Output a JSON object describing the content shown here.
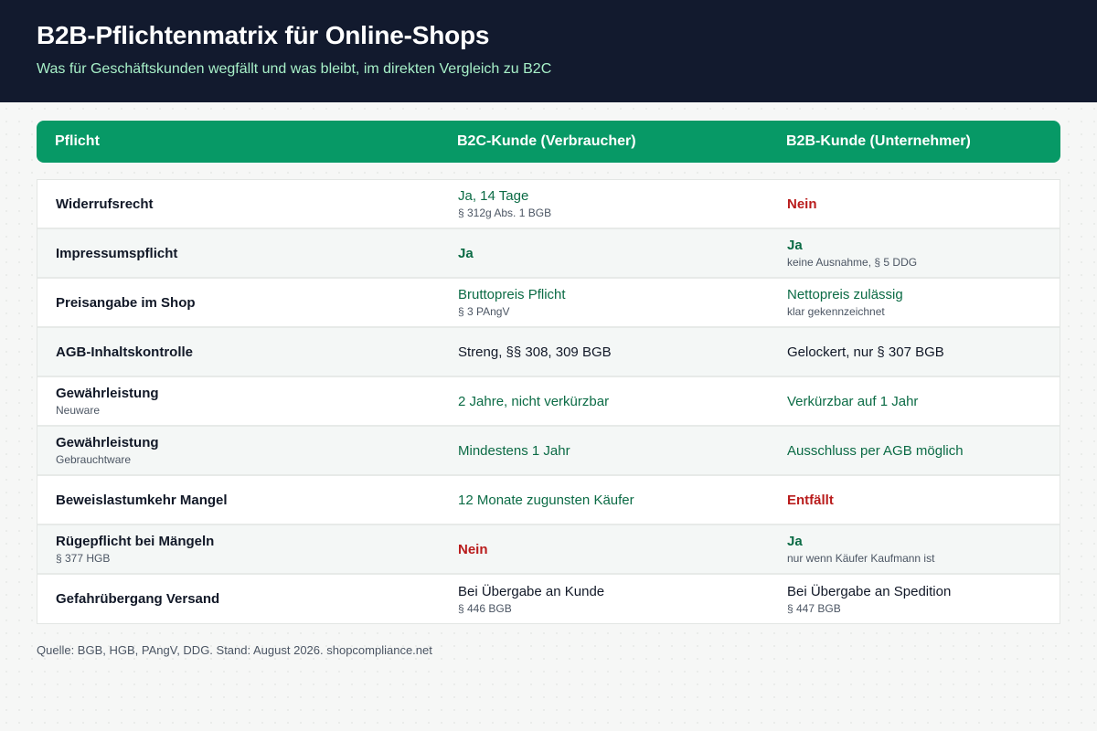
{
  "header": {
    "title": "B2B-Pflichtenmatrix für Online-Shops",
    "subtitle": "Was für Geschäftskunden wegfällt und was bleibt, im direkten Vergleich zu B2C"
  },
  "table": {
    "columns": [
      "Pflicht",
      "B2C-Kunde (Verbraucher)",
      "B2B-Kunde (Unternehmer)"
    ],
    "rows": [
      {
        "pflicht": "Widerrufsrecht",
        "pflicht_note": "",
        "b2c": "Ja, 14 Tage",
        "b2c_note": "§ 312g Abs. 1 BGB",
        "b2b": "Nein",
        "b2b_note": ""
      },
      {
        "pflicht": "Impressumspflicht",
        "pflicht_note": "",
        "b2c": "Ja",
        "b2c_note": "",
        "b2b": "Ja",
        "b2b_note": "keine Ausnahme, § 5 DDG"
      },
      {
        "pflicht": "Preisangabe im Shop",
        "pflicht_note": "",
        "b2c": "Bruttopreis Pflicht",
        "b2c_note": "§ 3 PAngV",
        "b2b": "Nettopreis zulässig",
        "b2b_note": "klar gekennzeichnet"
      },
      {
        "pflicht": "AGB-Inhaltskontrolle",
        "pflicht_note": "",
        "b2c": "Streng, §§ 308, 309 BGB",
        "b2c_note": "",
        "b2b": "Gelockert, nur § 307 BGB",
        "b2b_note": ""
      },
      {
        "pflicht": "Gewährleistung",
        "pflicht_note": "Neuware",
        "b2c": "2 Jahre, nicht verkürzbar",
        "b2c_note": "",
        "b2b": "Verkürzbar auf 1 Jahr",
        "b2b_note": ""
      },
      {
        "pflicht": "Gewährleistung",
        "pflicht_note": "Gebrauchtware",
        "b2c": "Mindestens 1 Jahr",
        "b2c_note": "",
        "b2b": "Ausschluss per AGB möglich",
        "b2b_note": ""
      },
      {
        "pflicht": "Beweislastumkehr Mangel",
        "pflicht_note": "",
        "b2c": "12 Monate zugunsten Käufer",
        "b2c_note": "",
        "b2b": "Entfällt",
        "b2b_note": ""
      },
      {
        "pflicht": "Rügepflicht bei Mängeln",
        "pflicht_note": "§ 377 HGB",
        "b2c": "Nein",
        "b2c_note": "",
        "b2b": "Ja",
        "b2b_note": "nur wenn Käufer Kaufmann ist"
      },
      {
        "pflicht": "Gefahrübergang Versand",
        "pflicht_note": "",
        "b2c": "Bei Übergabe an Kunde",
        "b2c_note": "§ 446 BGB",
        "b2b": "Bei Übergabe an Spedition",
        "b2b_note": "§ 447 BGB"
      }
    ]
  },
  "footer": {
    "source": "Quelle: BGB, HGB, PAngV, DDG. Stand: August 2026. shopcompliance.net"
  },
  "colors": {
    "header_bg": "#121a2e",
    "accent_green": "#079966",
    "text_green": "#0b6b45",
    "text_red": "#b91c1c"
  }
}
